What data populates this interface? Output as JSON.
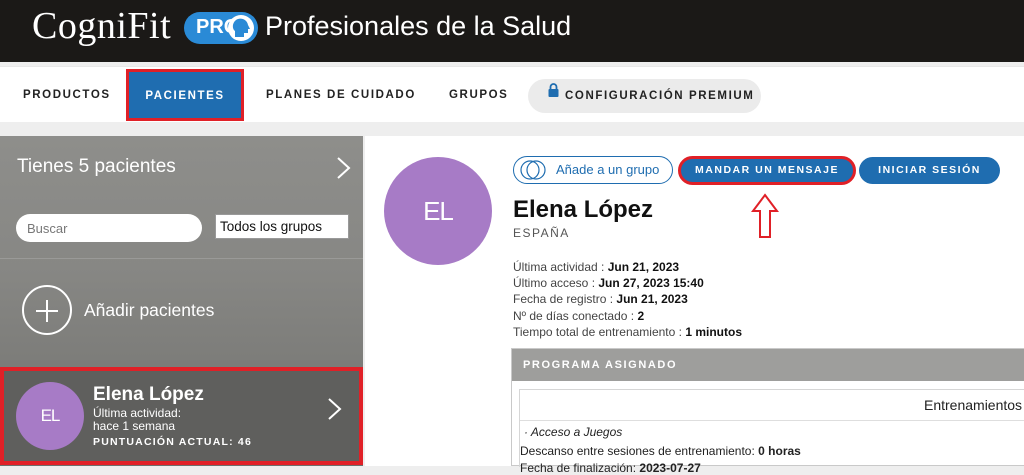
{
  "brand": {
    "logo_text": "CogniFit",
    "pro_badge": "PRO",
    "tagline": "Profesionales de la Salud"
  },
  "nav": {
    "items": [
      {
        "label": "PRODUCTOS"
      },
      {
        "label": "PACIENTES",
        "active": true
      },
      {
        "label": "PLANES DE CUIDADO"
      },
      {
        "label": "GRUPOS"
      },
      {
        "label": "CONFIGURACIÓN PREMIUM",
        "icon": "lock-icon"
      }
    ]
  },
  "sidebar": {
    "title": "Tienes 5 pacientes",
    "search_placeholder": "Buscar",
    "group_filter": "Todos los grupos",
    "add_label": "Añadir pacientes",
    "patient": {
      "initials": "EL",
      "name": "Elena López",
      "activity_line1": "Última actividad:",
      "activity_line2": "hace 1 semana",
      "score": "PUNTUACIÓN ACTUAL: 46"
    }
  },
  "profile": {
    "initials": "EL",
    "name": "Elena López",
    "country": "ESPAÑA",
    "buttons": {
      "add_group": "Añade a un grupo",
      "send_message": "MANDAR UN MENSAJE",
      "login": "INICIAR SESIÓN"
    },
    "info": [
      {
        "label": "Última actividad : ",
        "value": "Jun 21, 2023"
      },
      {
        "label": "Último acceso : ",
        "value": "Jun 27, 2023 15:40"
      },
      {
        "label": "Fecha de registro : ",
        "value": "Jun 21, 2023"
      },
      {
        "label": "Nº de días conectado : ",
        "value": "2"
      },
      {
        "label": "Tiempo total de entrenamiento : ",
        "value": "1 minutos"
      }
    ]
  },
  "program": {
    "header": "PROGRAMA ASIGNADO",
    "column": "Entrenamientos",
    "access": "Acceso a Juegos",
    "rest_label": "Descanso entre sesiones de entrenamiento: ",
    "rest_value": "0 horas",
    "end_label": "Fecha de finalización: ",
    "end_value": "2023-07-27"
  },
  "colors": {
    "accent": "#1f6db0",
    "highlight": "#e02027",
    "avatar": "#a77bc6"
  }
}
